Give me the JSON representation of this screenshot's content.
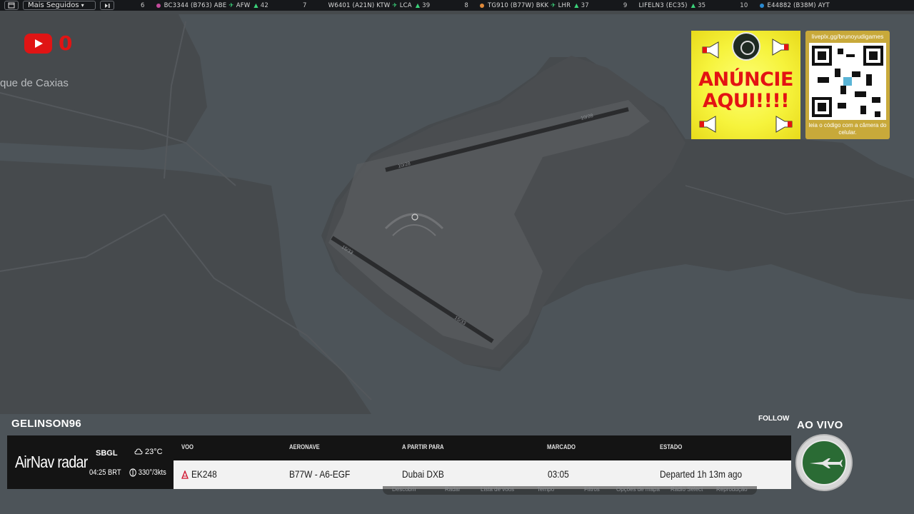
{
  "topbar": {
    "filter_label": "Mais Seguidos",
    "tickers": [
      {
        "rank": "6",
        "flight": "BC3344 (B763) ABE",
        "dest": "AFW",
        "count": "42",
        "color": "#c24a9a"
      },
      {
        "rank": "7",
        "flight": "W6401 (A21N) KTW",
        "dest": "LCA",
        "count": "39",
        "color": "#7a2a8a"
      },
      {
        "rank": "8",
        "flight": "TG910 (B77W) BKK",
        "dest": "LHR",
        "count": "37",
        "color": "#e08a3a"
      },
      {
        "rank": "9",
        "flight": "LIFELN3 (EC35)",
        "dest": "",
        "count": "35",
        "color": ""
      },
      {
        "rank": "10",
        "flight": "E44882 (B38M) AYT",
        "dest": "",
        "count": "",
        "color": "#2a8ad0"
      }
    ]
  },
  "youtube": {
    "count": "0"
  },
  "map": {
    "place_label": "que de Caxias",
    "runway_labels": [
      "10/28",
      "10/28",
      "15/33",
      "15/33"
    ]
  },
  "ads": {
    "banner_text": "ANÚNCIE AQUI!!!!",
    "qr_top": "liveplx.gg/brunoyudigames",
    "qr_bottom": "leia o código com a câmera do celular."
  },
  "stream": {
    "channel": "GELINSON96",
    "follow": "FOLLOW",
    "live": "AO VIVO"
  },
  "airnav": {
    "brand_a": "AirNav",
    "brand_b": " radar",
    "airport": "SBGL",
    "time": "04:25 BRT",
    "temp": "23°C",
    "wind": "330°/3kts",
    "headers": {
      "voo": "VOO",
      "aeronave": "AERONAVE",
      "partir": "A PARTIR PARA",
      "marcado": "MARCADO",
      "estado": "ESTADO"
    },
    "row": {
      "flight": "EK248",
      "aircraft": "B77W - A6-EGF",
      "destination": "Dubai DXB",
      "scheduled": "03:05",
      "status": "Departed 1h 13m ago"
    }
  },
  "menu": [
    "Descobrir",
    "Radar",
    "Lista de voos",
    "Tempo",
    "Filtros",
    "Opções de mapa",
    "Radio Select",
    "Reprodução"
  ]
}
